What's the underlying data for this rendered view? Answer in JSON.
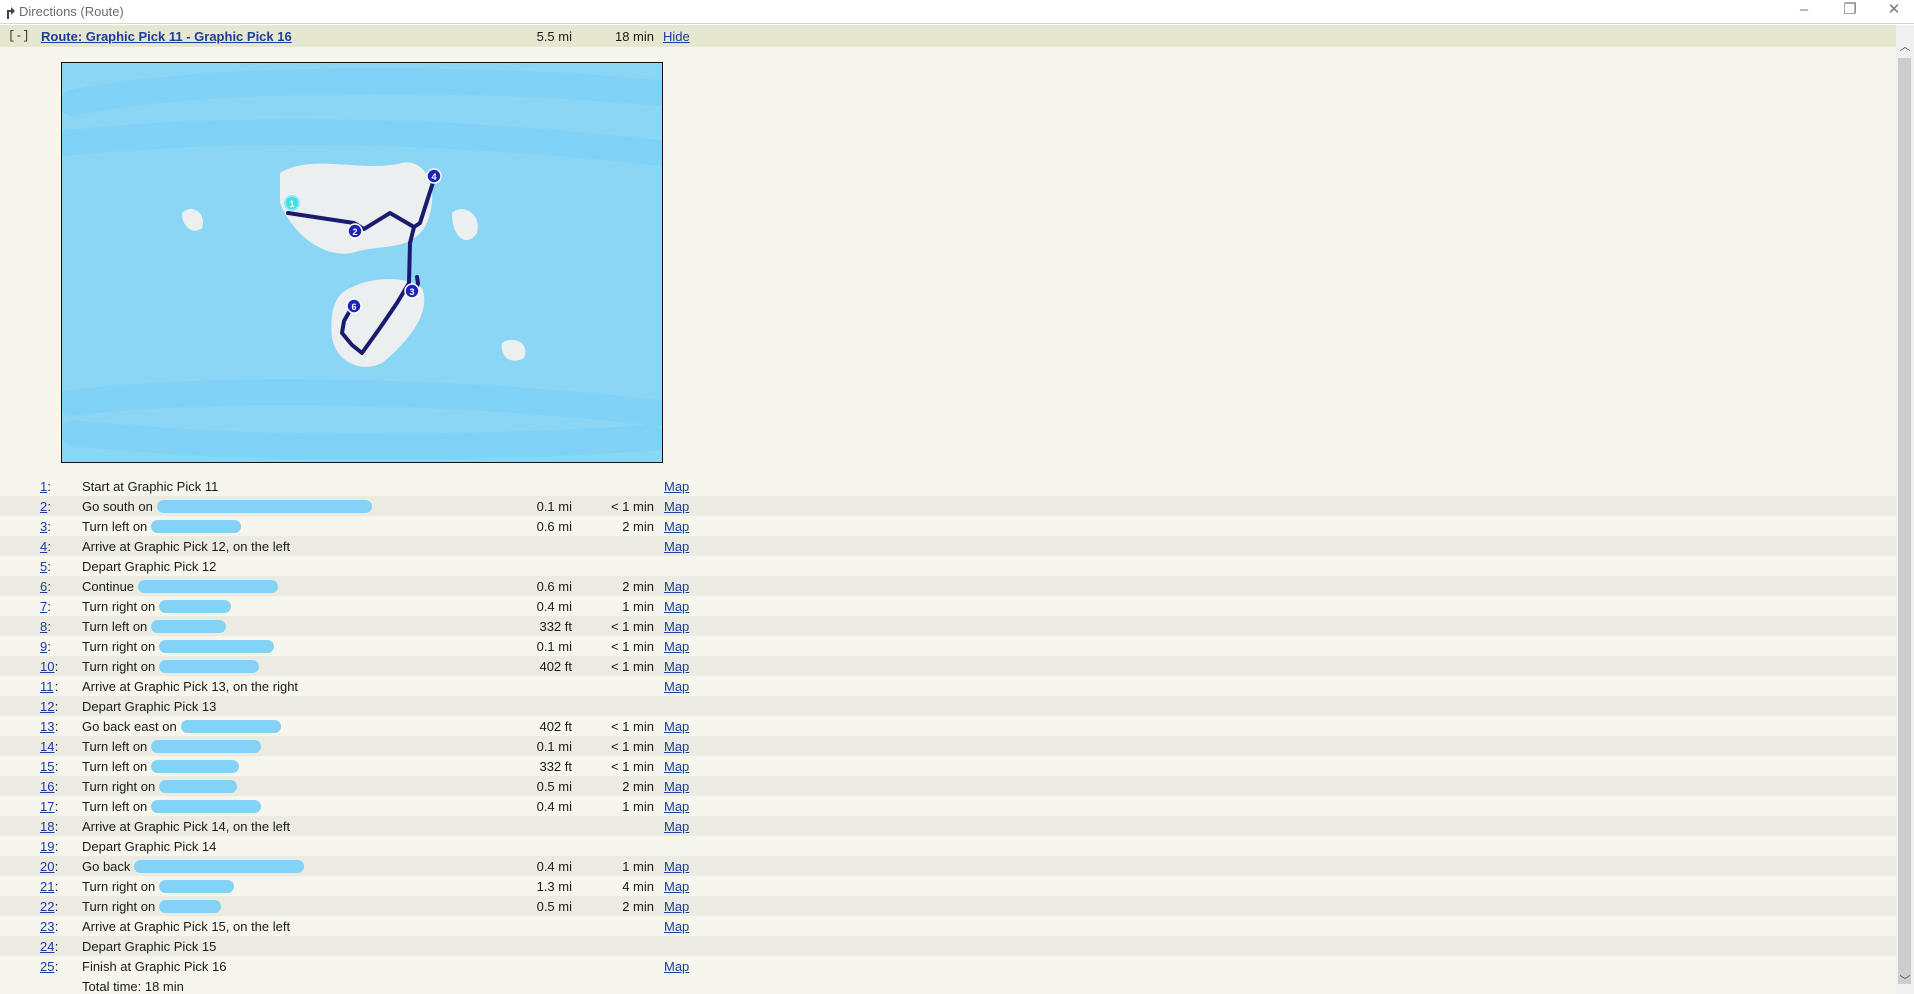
{
  "window": {
    "title": "Directions (Route)"
  },
  "route": {
    "toggle_label": "[-]",
    "link_label": "Route: Graphic Pick 11 - Graphic Pick 16",
    "distance": "5.5 mi",
    "time": "18 min",
    "hide_label": "Hide"
  },
  "map": {
    "markers": [
      {
        "label": "1",
        "color": "#3be3e0"
      },
      {
        "label": "2",
        "color": "#1b23b8"
      },
      {
        "label": "3",
        "color": "#1b23b8"
      },
      {
        "label": "4",
        "color": "#1b23b8"
      },
      {
        "label": "6",
        "color": "#1b23b8"
      }
    ],
    "route_color": "#1a1a6e",
    "redaction_color": "#84d3f7"
  },
  "steps": [
    {
      "num": "1",
      "desc": "Start at Graphic Pick 11",
      "dist": "",
      "time": "",
      "map": "Map"
    },
    {
      "num": "2",
      "desc": "Go south on",
      "dist": "0.1 mi",
      "time": "< 1 min",
      "map": "Map"
    },
    {
      "num": "3",
      "desc": "Turn left on",
      "dist": "0.6 mi",
      "time": "2 min",
      "map": "Map"
    },
    {
      "num": "4",
      "desc": "Arrive at Graphic Pick 12, on the left",
      "dist": "",
      "time": "",
      "map": "Map"
    },
    {
      "num": "5",
      "desc": "Depart Graphic Pick 12",
      "dist": "",
      "time": "",
      "map": ""
    },
    {
      "num": "6",
      "desc": "Continue",
      "dist": "0.6 mi",
      "time": "2 min",
      "map": "Map"
    },
    {
      "num": "7",
      "desc": "Turn right on",
      "dist": "0.4 mi",
      "time": "1 min",
      "map": "Map"
    },
    {
      "num": "8",
      "desc": "Turn left on",
      "dist": "332 ft",
      "time": "< 1 min",
      "map": "Map"
    },
    {
      "num": "9",
      "desc": "Turn right on",
      "dist": "0.1 mi",
      "time": "< 1 min",
      "map": "Map"
    },
    {
      "num": "10",
      "desc": "Turn right on",
      "dist": "402 ft",
      "time": "< 1 min",
      "map": "Map"
    },
    {
      "num": "11",
      "desc": "Arrive at Graphic Pick 13, on the right",
      "dist": "",
      "time": "",
      "map": "Map"
    },
    {
      "num": "12",
      "desc": "Depart Graphic Pick 13",
      "dist": "",
      "time": "",
      "map": ""
    },
    {
      "num": "13",
      "desc": "Go back east on",
      "dist": "402 ft",
      "time": "< 1 min",
      "map": "Map"
    },
    {
      "num": "14",
      "desc": "Turn left on",
      "dist": "0.1 mi",
      "time": "< 1 min",
      "map": "Map"
    },
    {
      "num": "15",
      "desc": "Turn left on",
      "dist": "332 ft",
      "time": "< 1 min",
      "map": "Map"
    },
    {
      "num": "16",
      "desc": "Turn right on",
      "dist": "0.5 mi",
      "time": "2 min",
      "map": "Map"
    },
    {
      "num": "17",
      "desc": "Turn left on",
      "dist": "0.4 mi",
      "time": "1 min",
      "map": "Map"
    },
    {
      "num": "18",
      "desc": "Arrive at Graphic Pick 14, on the left",
      "dist": "",
      "time": "",
      "map": "Map"
    },
    {
      "num": "19",
      "desc": "Depart Graphic Pick 14",
      "dist": "",
      "time": "",
      "map": ""
    },
    {
      "num": "20",
      "desc": "Go back",
      "dist": "0.4 mi",
      "time": "1 min",
      "map": "Map"
    },
    {
      "num": "21",
      "desc": "Turn right on",
      "dist": "1.3 mi",
      "time": "4 min",
      "map": "Map"
    },
    {
      "num": "22",
      "desc": "Turn right on",
      "dist": "0.5 mi",
      "time": "2 min",
      "map": "Map"
    },
    {
      "num": "23",
      "desc": "Arrive at Graphic Pick 15, on the left",
      "dist": "",
      "time": "",
      "map": "Map"
    },
    {
      "num": "24",
      "desc": "Depart Graphic Pick 15",
      "dist": "",
      "time": "",
      "map": ""
    },
    {
      "num": "25",
      "desc": "Finish at Graphic Pick 16",
      "dist": "",
      "time": "",
      "map": "Map"
    }
  ],
  "total_time": "Total time: 18 min"
}
